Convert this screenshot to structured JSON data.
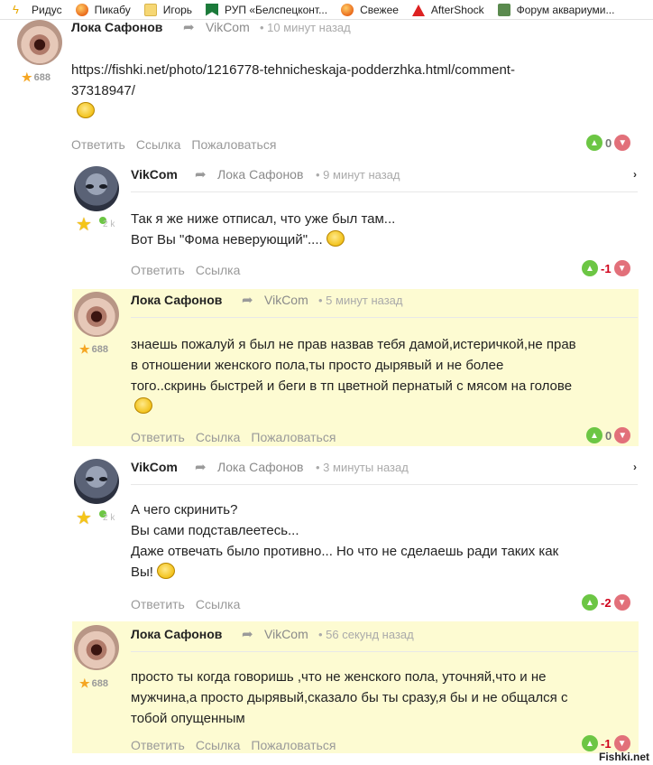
{
  "bookmarks": [
    {
      "label": "Ридус",
      "icon": "ridus-icon"
    },
    {
      "label": "Пикабу",
      "icon": "pikabu-icon"
    },
    {
      "label": "Игорь",
      "icon": "folder-icon"
    },
    {
      "label": "РУП «Белспецконт...",
      "icon": "rup-icon"
    },
    {
      "label": "Свежее",
      "icon": "pikabu-icon"
    },
    {
      "label": "AfterShock",
      "icon": "aftershock-icon"
    },
    {
      "label": "Форум аквариуми...",
      "icon": "forum-icon"
    }
  ],
  "actions": {
    "reply": "Ответить",
    "link": "Ссылка",
    "report": "Пожаловаться"
  },
  "comments": [
    {
      "author": "Лока Сафонов",
      "reply_to": "VikCom",
      "time": "• 10 минут назад",
      "rating": "688",
      "lines": [
        "https://fishki.net/photo/1216778-tehnicheskaja-podderzhka.html/comment-",
        "37318947/"
      ],
      "score": "0"
    },
    {
      "author": "VikCom",
      "reply_to": "Лока Сафонов",
      "time": "• 9 минут назад",
      "rating_faint": "2 k",
      "lines": [
        "Так я же ниже отписал, что уже был там...",
        "Вот Вы \"Фома неверующий\"...."
      ],
      "score": "-1"
    },
    {
      "author": "Лока Сафонов",
      "reply_to": "VikCom",
      "time": "• 5 минут назад",
      "rating": "688",
      "lines": [
        "знаешь пожалуй я был не прав назвав тебя дамой,истеричкой,не прав",
        "в отношении женского пола,ты просто дырявый и не более",
        "того..скринь быстрей и беги в тп цветной пернатый с мясом на голове"
      ],
      "score": "0"
    },
    {
      "author": "VikCom",
      "reply_to": "Лока Сафонов",
      "time": "• 3 минуты назад",
      "rating_faint": "2 k",
      "lines": [
        "А чего скринить?",
        "Вы сами подставлеетесь...",
        "Даже отвечать было противно... Но что не сделаешь ради таких как",
        "Вы!"
      ],
      "score": "-2"
    },
    {
      "author": "Лока Сафонов",
      "reply_to": "VikCom",
      "time": "• 56 секунд назад",
      "rating": "688",
      "lines": [
        "просто ты когда говоришь ,что не женского пола, уточняй,что и не",
        "мужчина,а просто дырявый,сказало бы ты сразу,я бы и не общался с",
        "тобой опущенным"
      ],
      "score": "-1"
    }
  ],
  "watermark": "Fishki.net"
}
